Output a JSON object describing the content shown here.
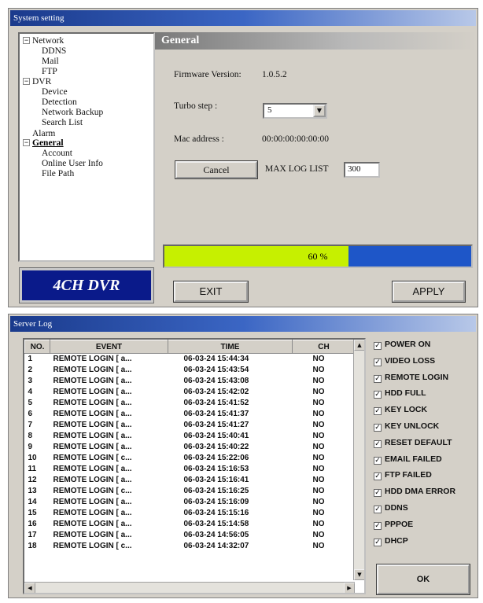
{
  "system_window": {
    "title": "System setting",
    "tree": [
      {
        "label": "Network",
        "level": 0,
        "expander": "−"
      },
      {
        "label": "DDNS",
        "level": 1
      },
      {
        "label": "Mail",
        "level": 1
      },
      {
        "label": "FTP",
        "level": 1
      },
      {
        "label": "DVR",
        "level": 0,
        "expander": "−"
      },
      {
        "label": "Device",
        "level": 1
      },
      {
        "label": "Detection",
        "level": 1
      },
      {
        "label": "Network Backup",
        "level": 1
      },
      {
        "label": "Search List",
        "level": 1
      },
      {
        "label": "Alarm",
        "level": 0
      },
      {
        "label": "General",
        "level": 0,
        "expander": "−",
        "selected": true
      },
      {
        "label": "Account",
        "level": 1
      },
      {
        "label": "Online User Info",
        "level": 1
      },
      {
        "label": "File Path",
        "level": 1
      }
    ],
    "logo_text": "4CH DVR",
    "panel_title": "General",
    "firmware_label": "Firmware Version:",
    "firmware_value": "1.0.5.2",
    "turbo_label": "Turbo step :",
    "turbo_value": "5",
    "mac_label": "Mac address :",
    "mac_value": "00:00:00:00:00:00",
    "cancel_label": "Cancel",
    "maxlog_label": "MAX LOG LIST",
    "maxlog_value": "300",
    "progress_percent": 60,
    "progress_text": "60 %",
    "exit_label": "EXIT",
    "apply_label": "APPLY"
  },
  "log_window": {
    "title": "Server Log",
    "columns": [
      "NO.",
      "EVENT",
      "TIME",
      "CH"
    ],
    "rows": [
      [
        "1",
        "REMOTE LOGIN [ a...",
        "06-03-24 15:44:34",
        "NO"
      ],
      [
        "2",
        "REMOTE LOGIN [ a...",
        "06-03-24 15:43:54",
        "NO"
      ],
      [
        "3",
        "REMOTE LOGIN [ a...",
        "06-03-24 15:43:08",
        "NO"
      ],
      [
        "4",
        "REMOTE LOGIN [ a...",
        "06-03-24 15:42:02",
        "NO"
      ],
      [
        "5",
        "REMOTE LOGIN [ a...",
        "06-03-24 15:41:52",
        "NO"
      ],
      [
        "6",
        "REMOTE LOGIN [ a...",
        "06-03-24 15:41:37",
        "NO"
      ],
      [
        "7",
        "REMOTE LOGIN [ a...",
        "06-03-24 15:41:27",
        "NO"
      ],
      [
        "8",
        "REMOTE LOGIN [ a...",
        "06-03-24 15:40:41",
        "NO"
      ],
      [
        "9",
        "REMOTE LOGIN [ a...",
        "06-03-24 15:40:22",
        "NO"
      ],
      [
        "10",
        "REMOTE LOGIN [ c...",
        "06-03-24 15:22:06",
        "NO"
      ],
      [
        "11",
        "REMOTE LOGIN [ a...",
        "06-03-24 15:16:53",
        "NO"
      ],
      [
        "12",
        "REMOTE LOGIN [ a...",
        "06-03-24 15:16:41",
        "NO"
      ],
      [
        "13",
        "REMOTE LOGIN [ c...",
        "06-03-24 15:16:25",
        "NO"
      ],
      [
        "14",
        "REMOTE LOGIN [ a...",
        "06-03-24 15:16:09",
        "NO"
      ],
      [
        "15",
        "REMOTE LOGIN [ a...",
        "06-03-24 15:15:16",
        "NO"
      ],
      [
        "16",
        "REMOTE LOGIN [ a...",
        "06-03-24 15:14:58",
        "NO"
      ],
      [
        "17",
        "REMOTE LOGIN [ a...",
        "06-03-24 14:56:05",
        "NO"
      ],
      [
        "18",
        "REMOTE LOGIN [ c...",
        "06-03-24 14:32:07",
        "NO"
      ]
    ],
    "filters": [
      {
        "label": "POWER ON",
        "checked": true
      },
      {
        "label": "VIDEO LOSS",
        "checked": true
      },
      {
        "label": "REMOTE LOGIN",
        "checked": true
      },
      {
        "label": "HDD FULL",
        "checked": true
      },
      {
        "label": "KEY LOCK",
        "checked": true
      },
      {
        "label": "KEY UNLOCK",
        "checked": true
      },
      {
        "label": "RESET DEFAULT",
        "checked": true
      },
      {
        "label": "EMAIL FAILED",
        "checked": true
      },
      {
        "label": "FTP FAILED",
        "checked": true
      },
      {
        "label": "HDD DMA ERROR",
        "checked": true
      },
      {
        "label": "DDNS",
        "checked": true
      },
      {
        "label": "PPPOE",
        "checked": true
      },
      {
        "label": "DHCP",
        "checked": true
      }
    ],
    "ok_label": "OK"
  }
}
